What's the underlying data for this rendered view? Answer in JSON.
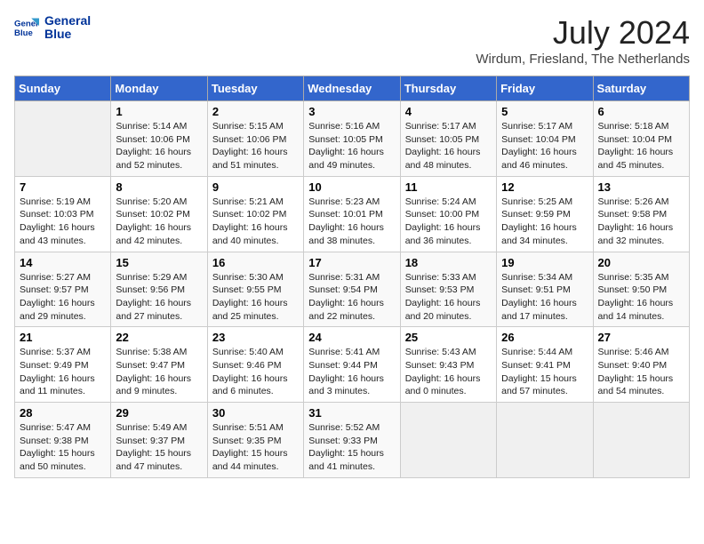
{
  "logo": {
    "line1": "General",
    "line2": "Blue"
  },
  "title": "July 2024",
  "location": "Wirdum, Friesland, The Netherlands",
  "weekdays": [
    "Sunday",
    "Monday",
    "Tuesday",
    "Wednesday",
    "Thursday",
    "Friday",
    "Saturday"
  ],
  "weeks": [
    [
      {
        "day": "",
        "info": ""
      },
      {
        "day": "1",
        "info": "Sunrise: 5:14 AM\nSunset: 10:06 PM\nDaylight: 16 hours\nand 52 minutes."
      },
      {
        "day": "2",
        "info": "Sunrise: 5:15 AM\nSunset: 10:06 PM\nDaylight: 16 hours\nand 51 minutes."
      },
      {
        "day": "3",
        "info": "Sunrise: 5:16 AM\nSunset: 10:05 PM\nDaylight: 16 hours\nand 49 minutes."
      },
      {
        "day": "4",
        "info": "Sunrise: 5:17 AM\nSunset: 10:05 PM\nDaylight: 16 hours\nand 48 minutes."
      },
      {
        "day": "5",
        "info": "Sunrise: 5:17 AM\nSunset: 10:04 PM\nDaylight: 16 hours\nand 46 minutes."
      },
      {
        "day": "6",
        "info": "Sunrise: 5:18 AM\nSunset: 10:04 PM\nDaylight: 16 hours\nand 45 minutes."
      }
    ],
    [
      {
        "day": "7",
        "info": "Sunrise: 5:19 AM\nSunset: 10:03 PM\nDaylight: 16 hours\nand 43 minutes."
      },
      {
        "day": "8",
        "info": "Sunrise: 5:20 AM\nSunset: 10:02 PM\nDaylight: 16 hours\nand 42 minutes."
      },
      {
        "day": "9",
        "info": "Sunrise: 5:21 AM\nSunset: 10:02 PM\nDaylight: 16 hours\nand 40 minutes."
      },
      {
        "day": "10",
        "info": "Sunrise: 5:23 AM\nSunset: 10:01 PM\nDaylight: 16 hours\nand 38 minutes."
      },
      {
        "day": "11",
        "info": "Sunrise: 5:24 AM\nSunset: 10:00 PM\nDaylight: 16 hours\nand 36 minutes."
      },
      {
        "day": "12",
        "info": "Sunrise: 5:25 AM\nSunset: 9:59 PM\nDaylight: 16 hours\nand 34 minutes."
      },
      {
        "day": "13",
        "info": "Sunrise: 5:26 AM\nSunset: 9:58 PM\nDaylight: 16 hours\nand 32 minutes."
      }
    ],
    [
      {
        "day": "14",
        "info": "Sunrise: 5:27 AM\nSunset: 9:57 PM\nDaylight: 16 hours\nand 29 minutes."
      },
      {
        "day": "15",
        "info": "Sunrise: 5:29 AM\nSunset: 9:56 PM\nDaylight: 16 hours\nand 27 minutes."
      },
      {
        "day": "16",
        "info": "Sunrise: 5:30 AM\nSunset: 9:55 PM\nDaylight: 16 hours\nand 25 minutes."
      },
      {
        "day": "17",
        "info": "Sunrise: 5:31 AM\nSunset: 9:54 PM\nDaylight: 16 hours\nand 22 minutes."
      },
      {
        "day": "18",
        "info": "Sunrise: 5:33 AM\nSunset: 9:53 PM\nDaylight: 16 hours\nand 20 minutes."
      },
      {
        "day": "19",
        "info": "Sunrise: 5:34 AM\nSunset: 9:51 PM\nDaylight: 16 hours\nand 17 minutes."
      },
      {
        "day": "20",
        "info": "Sunrise: 5:35 AM\nSunset: 9:50 PM\nDaylight: 16 hours\nand 14 minutes."
      }
    ],
    [
      {
        "day": "21",
        "info": "Sunrise: 5:37 AM\nSunset: 9:49 PM\nDaylight: 16 hours\nand 11 minutes."
      },
      {
        "day": "22",
        "info": "Sunrise: 5:38 AM\nSunset: 9:47 PM\nDaylight: 16 hours\nand 9 minutes."
      },
      {
        "day": "23",
        "info": "Sunrise: 5:40 AM\nSunset: 9:46 PM\nDaylight: 16 hours\nand 6 minutes."
      },
      {
        "day": "24",
        "info": "Sunrise: 5:41 AM\nSunset: 9:44 PM\nDaylight: 16 hours\nand 3 minutes."
      },
      {
        "day": "25",
        "info": "Sunrise: 5:43 AM\nSunset: 9:43 PM\nDaylight: 16 hours\nand 0 minutes."
      },
      {
        "day": "26",
        "info": "Sunrise: 5:44 AM\nSunset: 9:41 PM\nDaylight: 15 hours\nand 57 minutes."
      },
      {
        "day": "27",
        "info": "Sunrise: 5:46 AM\nSunset: 9:40 PM\nDaylight: 15 hours\nand 54 minutes."
      }
    ],
    [
      {
        "day": "28",
        "info": "Sunrise: 5:47 AM\nSunset: 9:38 PM\nDaylight: 15 hours\nand 50 minutes."
      },
      {
        "day": "29",
        "info": "Sunrise: 5:49 AM\nSunset: 9:37 PM\nDaylight: 15 hours\nand 47 minutes."
      },
      {
        "day": "30",
        "info": "Sunrise: 5:51 AM\nSunset: 9:35 PM\nDaylight: 15 hours\nand 44 minutes."
      },
      {
        "day": "31",
        "info": "Sunrise: 5:52 AM\nSunset: 9:33 PM\nDaylight: 15 hours\nand 41 minutes."
      },
      {
        "day": "",
        "info": ""
      },
      {
        "day": "",
        "info": ""
      },
      {
        "day": "",
        "info": ""
      }
    ]
  ]
}
